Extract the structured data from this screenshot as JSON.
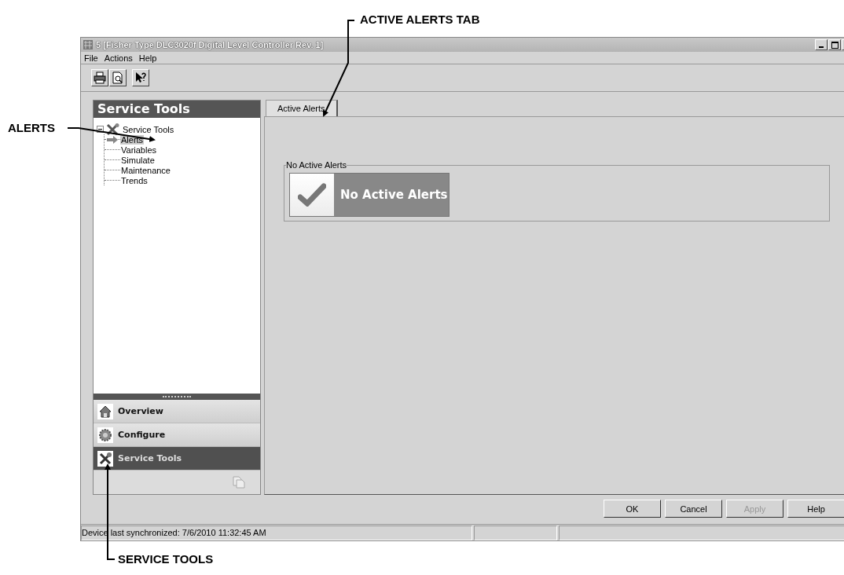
{
  "window": {
    "title": "5 [Fisher Type DLC3020f Digital Level Controller Rev. 1]"
  },
  "menu": [
    "File",
    "Actions",
    "Help"
  ],
  "sidebar": {
    "header": "Service Tools",
    "tree": {
      "label": "Service Tools",
      "expanded": true,
      "children": [
        {
          "label": "Alerts",
          "selected": true
        },
        {
          "label": "Variables",
          "selected": false
        },
        {
          "label": "Simulate",
          "selected": false
        },
        {
          "label": "Maintenance",
          "selected": false
        },
        {
          "label": "Trends",
          "selected": false
        }
      ]
    },
    "nav": [
      {
        "label": "Overview",
        "kind": "home",
        "selected": false
      },
      {
        "label": "Configure",
        "kind": "gear",
        "selected": false
      },
      {
        "label": "Service Tools",
        "kind": "tools",
        "selected": true
      }
    ]
  },
  "tabs": [
    {
      "label": "Active Alerts",
      "selected": true
    }
  ],
  "group": {
    "title": "No Active Alerts",
    "status": "No Active Alerts"
  },
  "buttons": [
    {
      "label": "OK",
      "disabled": false
    },
    {
      "label": "Cancel",
      "disabled": false
    },
    {
      "label": "Apply",
      "disabled": true
    },
    {
      "label": "Help",
      "disabled": false
    }
  ],
  "status_bar": "Device last synchronized: 7/6/2010 11:32:45 AM",
  "callouts": [
    {
      "label": "ACTIVE ALERTS TAB"
    },
    {
      "label": "ALERTS"
    },
    {
      "label": "SERVICE TOOLS"
    }
  ]
}
